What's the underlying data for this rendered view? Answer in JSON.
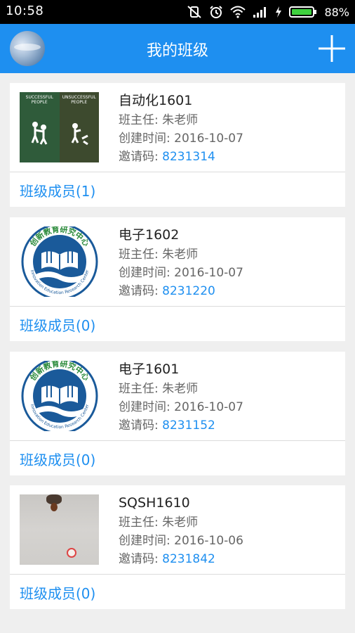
{
  "status_bar": {
    "time": "10:58",
    "battery": "88%"
  },
  "app_bar": {
    "title": "我的班级"
  },
  "labels": {
    "teacher_prefix": "班主任: ",
    "created_prefix": "创建时间: ",
    "invite_prefix": "邀请码: "
  },
  "classes": [
    {
      "name": "自动化1601",
      "teacher": "朱老师",
      "created": "2016-10-07",
      "invite_code": "8231314",
      "members_label": "班级成员(1)",
      "thumbnail": "successful-people-poster"
    },
    {
      "name": "电子1602",
      "teacher": "朱老师",
      "created": "2016-10-07",
      "invite_code": "8231220",
      "members_label": "班级成员(0)",
      "thumbnail": "innovation-center-logo"
    },
    {
      "name": "电子1601",
      "teacher": "朱老师",
      "created": "2016-10-07",
      "invite_code": "8231152",
      "members_label": "班级成员(0)",
      "thumbnail": "innovation-center-logo"
    },
    {
      "name": "SQSH1610",
      "teacher": "朱老师",
      "created": "2016-10-06",
      "invite_code": "8231842",
      "members_label": "班级成员(0)",
      "thumbnail": "photo"
    }
  ],
  "logo_text": {
    "top": "创新教育研究中心",
    "bottom": "Innovation Education Research Center"
  },
  "poster_text": {
    "left": "SUCCESSFUL PEOPLE",
    "right": "UNSUCCESSFUL PEOPLE"
  },
  "colors": {
    "accent": "#1e8ff0",
    "background": "#efefef"
  }
}
